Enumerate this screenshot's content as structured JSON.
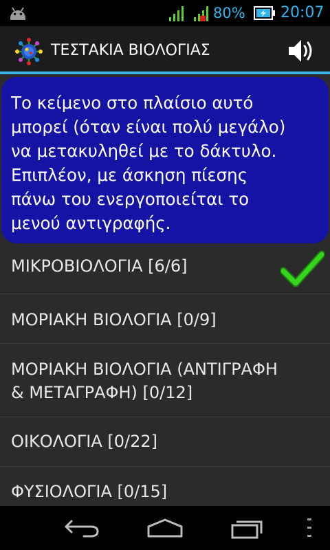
{
  "status_bar": {
    "battery_percent": "80%",
    "time": "20:07",
    "icons": [
      "android-notification-icon",
      "signal-icon",
      "signal-no-data-icon",
      "battery-charging-icon"
    ],
    "accent_color": "#2fb6f0"
  },
  "action_bar": {
    "title": "ΤΕΣΤΑΚΙΑ ΒΙΟΛΟΓΙΑΣ",
    "app_icon": "virus-icon",
    "sound_icon": "speaker-icon",
    "divider_color": "#33b5e5"
  },
  "info_box": {
    "lines": [
      "Το κείμενο στο πλαίσιο αυτό",
      "μπορεί (όταν είναι πολύ μεγάλο)",
      "να μετακυληθεί με το δάκτυλο.",
      "Επιπλέον, με άσκηση πίεσης",
      "πάνω του ενεργοποιείται το",
      "μενού αντιγραφής."
    ],
    "background_color": "#1513a3"
  },
  "topics": [
    {
      "lines": [
        "ΜΙΚΡΟΒΙΟΛΟΓΙΑ [6/6]"
      ],
      "completed": true
    },
    {
      "lines": [
        "ΜΟΡΙΑΚΗ ΒΙΟΛΟΓΙΑ [0/9]"
      ],
      "completed": false
    },
    {
      "lines": [
        "ΜΟΡΙΑΚΗ ΒΙΟΛΟΓΙΑ (ΑΝΤΙΓΡΑΦΗ",
        "& ΜΕΤΑΓΡΑΦΗ) [0/12]"
      ],
      "completed": false
    },
    {
      "lines": [
        "ΟΙΚΟΛΟΓΙΑ [0/22]"
      ],
      "completed": false
    },
    {
      "lines": [
        "ΦΥΣΙΟΛΟΓΙΑ [0/15]"
      ],
      "completed": false
    }
  ],
  "nav_bar": {
    "icons": [
      "back-icon",
      "home-icon",
      "recent-apps-icon",
      "menu-icon"
    ]
  }
}
